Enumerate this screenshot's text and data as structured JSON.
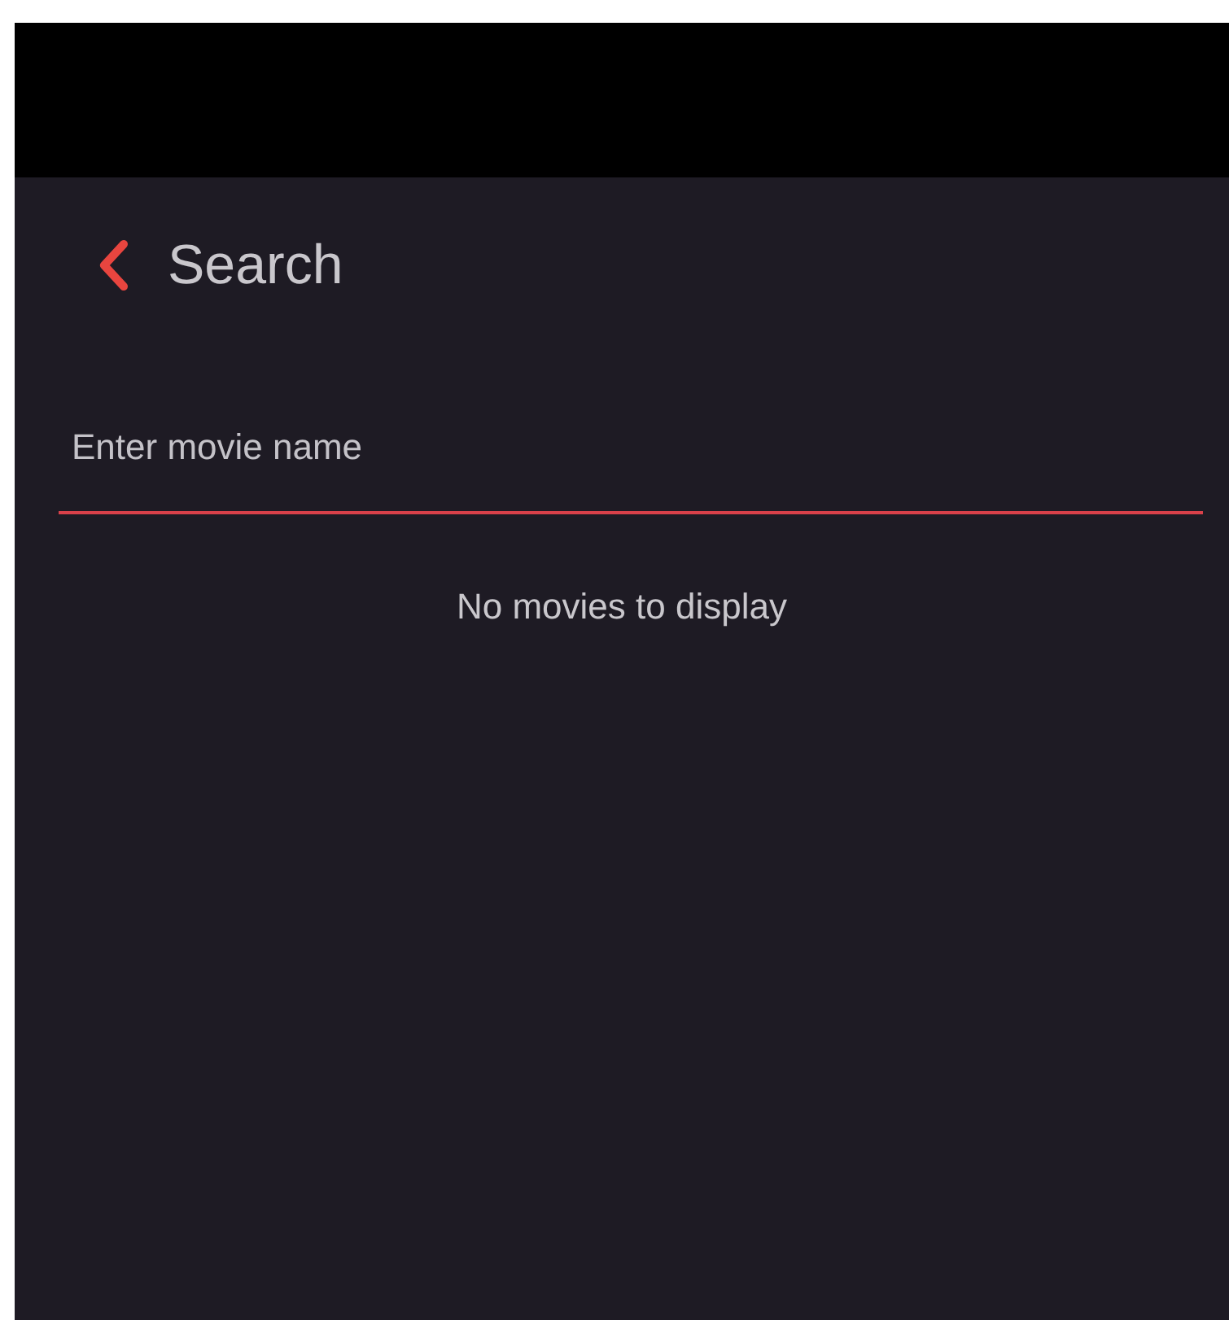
{
  "header": {
    "title": "Search"
  },
  "search": {
    "placeholder": "Enter movie name"
  },
  "empty_message": "No movies to display"
}
